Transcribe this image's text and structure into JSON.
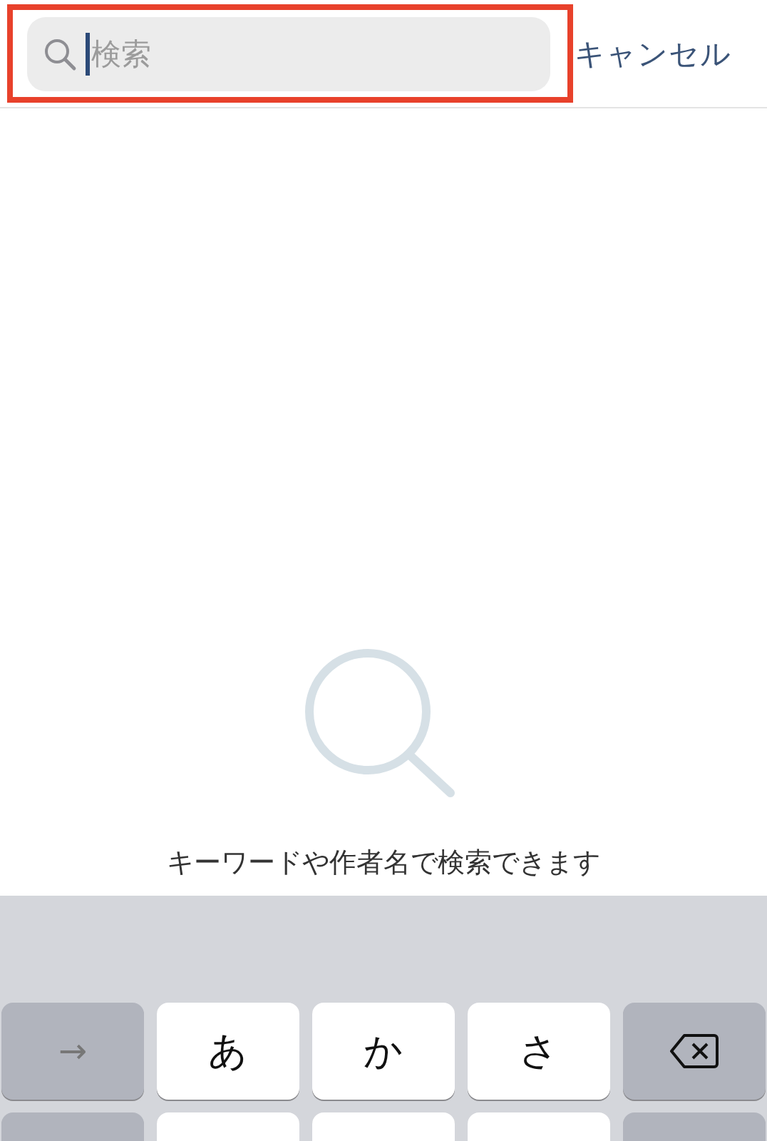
{
  "search": {
    "placeholder": "検索",
    "focused": true,
    "highlighted": true
  },
  "cancel_button": {
    "label": "キャンセル"
  },
  "empty_state": {
    "message": "キーワードや作者名で検索できます"
  },
  "keyboard": {
    "rows": [
      [
        {
          "kind": "text",
          "label": "→",
          "dark": true
        },
        {
          "kind": "text",
          "label": "あ",
          "dark": false
        },
        {
          "kind": "text",
          "label": "か",
          "dark": false
        },
        {
          "kind": "text",
          "label": "さ",
          "dark": false
        },
        {
          "kind": "backspace",
          "dark": true
        }
      ],
      [
        {
          "kind": "blank",
          "dark": true
        },
        {
          "kind": "blank",
          "dark": false
        },
        {
          "kind": "blank",
          "dark": false
        },
        {
          "kind": "blank",
          "dark": false
        },
        {
          "kind": "blank",
          "dark": true
        }
      ]
    ]
  }
}
